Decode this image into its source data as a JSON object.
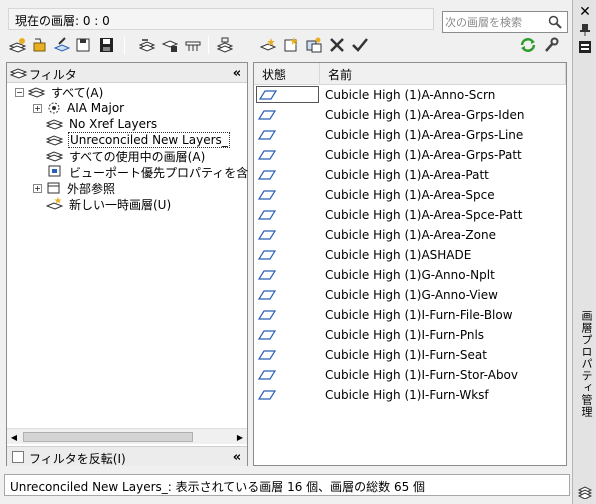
{
  "current_layer_label": "現在の画層: 0 : 0",
  "search": {
    "placeholder": "次の画層を検索"
  },
  "filter_panel": {
    "title": "フィルタ",
    "tree": [
      {
        "label": "すべて(A)",
        "selected": false
      },
      {
        "label": "AIA Major",
        "selected": false
      },
      {
        "label": "No Xref Layers",
        "selected": false
      },
      {
        "label": "Unreconciled New Layers_",
        "selected": true
      },
      {
        "label": "すべての使用中の画層(A)",
        "selected": false
      },
      {
        "label": "ビューポート優先プロパティを含",
        "selected": false
      },
      {
        "label": "外部参照",
        "selected": false
      },
      {
        "label": "新しい一時画層(U)",
        "selected": false
      }
    ],
    "invert_label": "フィルタを反転(I)"
  },
  "layer_list": {
    "columns": [
      "状態",
      "名前"
    ],
    "rows": [
      "Cubicle High (1)A-Anno-Scrn",
      "Cubicle High (1)A-Area-Grps-Iden",
      "Cubicle High (1)A-Area-Grps-Line",
      "Cubicle High (1)A-Area-Grps-Patt",
      "Cubicle High (1)A-Area-Patt",
      "Cubicle High (1)A-Area-Spce",
      "Cubicle High (1)A-Area-Spce-Patt",
      "Cubicle High (1)A-Area-Zone",
      "Cubicle High (1)ASHADE",
      "Cubicle High (1)G-Anno-Nplt",
      "Cubicle High (1)G-Anno-View",
      "Cubicle High (1)I-Furn-File-Blow",
      "Cubicle High (1)I-Furn-Pnls",
      "Cubicle High (1)I-Furn-Seat",
      "Cubicle High (1)I-Furn-Stor-Abov",
      "Cubicle High (1)I-Furn-Wksf"
    ]
  },
  "status_text": "Unreconciled New Layers_: 表示されている画層 16 個、画層の総数 65 個",
  "palette_title": "画層プロパティ管理",
  "colors": {
    "layer_icon": "#2a5fb8",
    "refresh_icon": "#2e9d2e",
    "accent_yellow": "#e8b020"
  }
}
